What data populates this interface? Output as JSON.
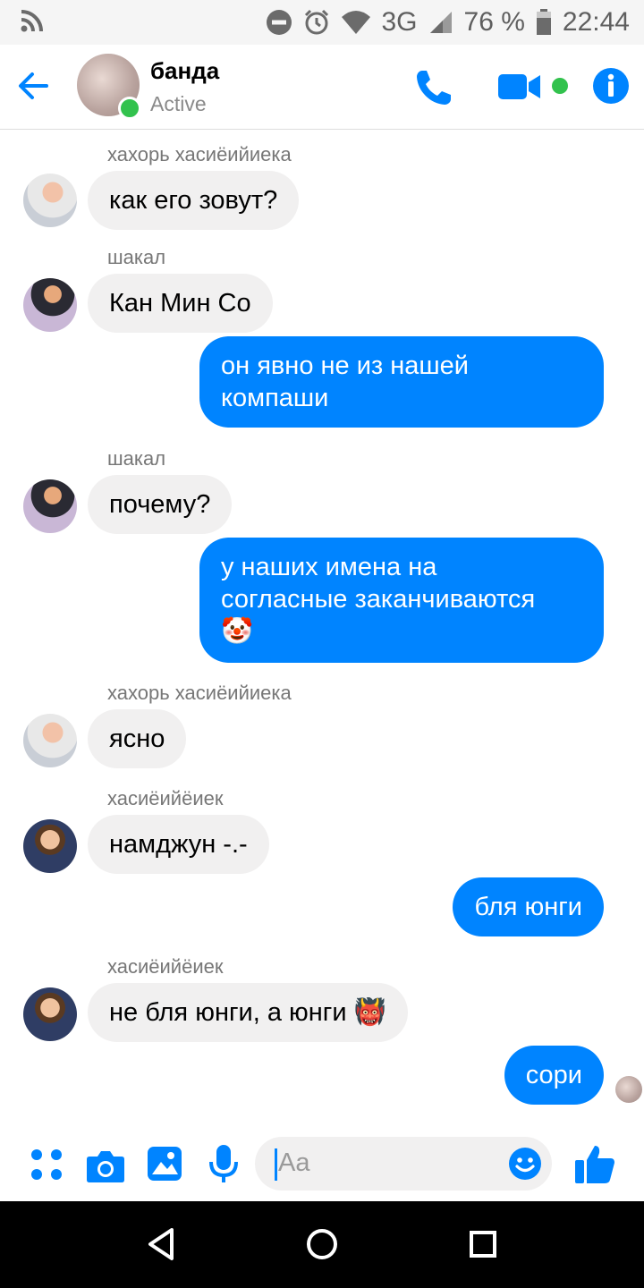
{
  "status_bar": {
    "network": "3G",
    "battery": "76 %",
    "time": "22:44"
  },
  "header": {
    "title": "банда",
    "status": "Active"
  },
  "messages": [
    {
      "direction": "in",
      "sender": "хахорь хасиёийиека",
      "text": "как его зовут?"
    },
    {
      "direction": "in",
      "sender": "шакал",
      "text": "Кан Мин Со"
    },
    {
      "direction": "out",
      "lines": [
        "он явно не из нашей",
        "компаши"
      ]
    },
    {
      "direction": "in",
      "sender": "шакал",
      "text": "почему?"
    },
    {
      "direction": "out",
      "lines": [
        "у наших имена на",
        "согласные заканчиваются",
        "🤡"
      ]
    },
    {
      "direction": "in",
      "sender": "хахорь хасиёийиека",
      "text": "ясно"
    },
    {
      "direction": "in",
      "sender": "хасиёийёиек",
      "text": "намджун -.-"
    },
    {
      "direction": "out",
      "text": "бля юнги"
    },
    {
      "direction": "in",
      "sender": "хасиёийёиек",
      "text": "не бля юнги, а юнги 👹"
    },
    {
      "direction": "out",
      "text": "сори"
    }
  ],
  "composer": {
    "placeholder": "Aa"
  },
  "colors": {
    "accent": "#0084ff",
    "incoming_bubble": "#f1f0f0",
    "online": "#32c24d"
  },
  "icons": {
    "status_bar": [
      "rss-icon",
      "dnd-icon",
      "alarm-icon",
      "wifi-icon",
      "signal-icon",
      "battery-icon"
    ],
    "header": [
      "back-arrow-icon",
      "phone-icon",
      "video-icon",
      "info-icon"
    ],
    "composer": [
      "more-icon",
      "camera-icon",
      "gallery-icon",
      "mic-icon",
      "emoji-icon",
      "like-icon"
    ],
    "nav": [
      "back-triangle-icon",
      "home-circle-icon",
      "recents-square-icon"
    ]
  }
}
